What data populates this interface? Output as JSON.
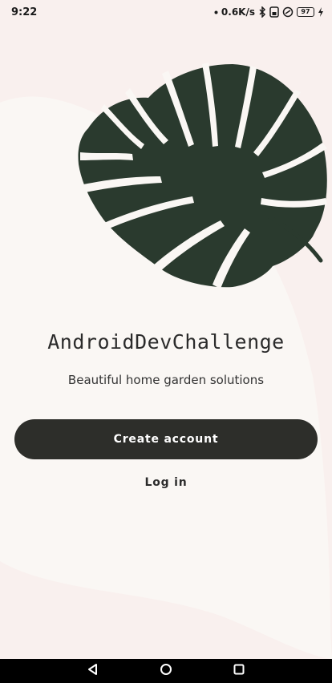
{
  "status_bar": {
    "time": "9:22",
    "network_speed": "0.6K/s",
    "battery_level": "97",
    "icons": [
      "dot-icon",
      "bluetooth-icon",
      "sim-icon",
      "data-saver-icon",
      "battery-icon",
      "charging-icon"
    ]
  },
  "hero": {
    "image": "monstera-leaf",
    "colors": {
      "leaf": "#2a3a2e",
      "background": "#f9f0ee",
      "blob": "#faf7f4"
    }
  },
  "app": {
    "title": "AndroidDevChallenge",
    "subtitle": "Beautiful home garden solutions"
  },
  "actions": {
    "create_account_label": "Create account",
    "login_label": "Log in",
    "colors": {
      "primary_button_bg": "#2d2e2a",
      "primary_button_text": "#ffffff"
    }
  },
  "nav_bar": {
    "buttons": [
      "back-icon",
      "home-icon",
      "recents-icon"
    ]
  }
}
